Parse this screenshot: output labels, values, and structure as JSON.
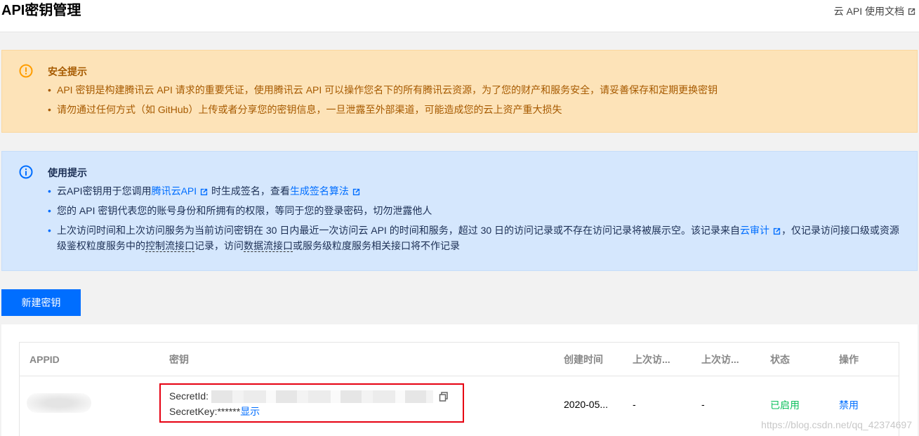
{
  "header": {
    "title": "API密钥管理",
    "doc_link": "云 API 使用文档"
  },
  "security_notice": {
    "title": "安全提示",
    "items": [
      "API 密钥是构建腾讯云 API 请求的重要凭证，使用腾讯云 API 可以操作您名下的所有腾讯云资源，为了您的财产和服务安全，请妥善保存和定期更换密钥",
      "请勿通过任何方式（如 GitHub）上传或者分享您的密钥信息，一旦泄露至外部渠道，可能造成您的云上资产重大损失"
    ]
  },
  "usage_notice": {
    "title": "使用提示",
    "item1": {
      "prefix": "云API密钥用于您调用",
      "link1": "腾讯云API",
      "middle": "时生成签名，查看",
      "link2": "生成签名算法"
    },
    "item2": "您的 API 密钥代表您的账号身份和所拥有的权限，等同于您的登录密码，切勿泄露他人",
    "item3": {
      "prefix": "上次访问时间和上次访问服务为当前访问密钥在 30 日内最近一次访问云 API 的时间和服务，超过 30 日的访问记录或不存在访问记录将被展示空。该记录来自",
      "link": "云审计",
      "part2": "，仅记录访问接口级或资源级鉴权粒度服务中的",
      "dashed1": "控制流接口",
      "part3": "记录，访问",
      "dashed2": "数据流接口",
      "part4": "或服务级粒度服务相关接口将不作记录"
    }
  },
  "new_key_button": "新建密钥",
  "table": {
    "headers": [
      "APPID",
      "密钥",
      "创建时间",
      "上次访...",
      "上次访...",
      "状态",
      "操作"
    ],
    "row": {
      "secret_id_label": "SecretId:",
      "secret_key_label": "SecretKey:",
      "secret_key_masked": "******",
      "show_link": "显示",
      "created": "2020-05...",
      "last_access_time": "-",
      "last_access_service": "-",
      "status": "已启用",
      "action": "禁用"
    }
  },
  "watermark": "https://blog.csdn.net/qq_42374697",
  "colors": {
    "accent": "#006eff",
    "warn_bg": "#fde3b8",
    "info_bg": "#d5e7fd",
    "enabled": "#0abf5b",
    "highlight_box": "#e60012"
  },
  "icons": {
    "doc_link": "external-link-icon",
    "security": "warning-circle-icon",
    "usage": "info-circle-icon",
    "copy": "copy-icon"
  }
}
